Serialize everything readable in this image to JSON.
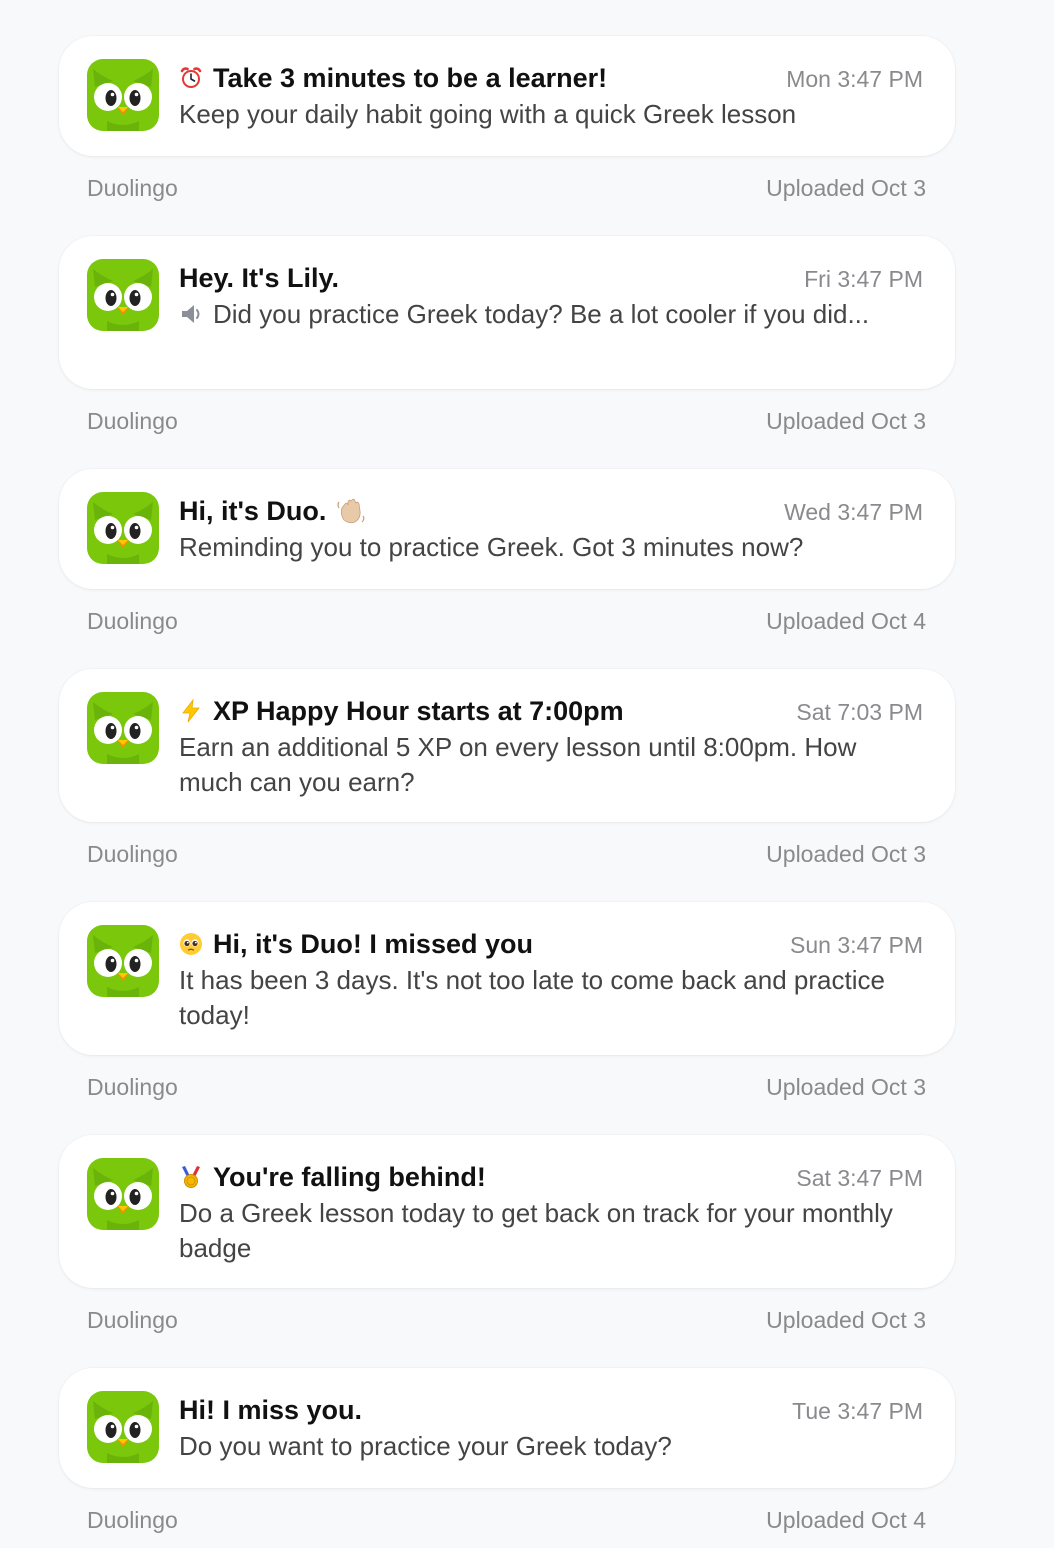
{
  "app": {
    "icon": "duolingo-owl-icon",
    "icon_color": "#7ac70c"
  },
  "notifications": [
    {
      "emoji_icon": "alarm-clock-icon",
      "title": "Take 3 minutes to be a learner!",
      "time": "Mon 3:47 PM",
      "body": "Keep your daily habit going with a quick Greek lesson",
      "source": "Duolingo",
      "uploaded": "Uploaded Oct 3"
    },
    {
      "emoji_icon": "",
      "title": "Hey. It's Lily.",
      "time": "Fri 3:47 PM",
      "body_icon": "speaker-icon",
      "body": "Did you practice Greek today? Be a lot cooler if you did...",
      "source": "Duolingo",
      "uploaded": "Uploaded Oct 3"
    },
    {
      "emoji_icon": "",
      "title": "Hi, it's Duo.",
      "title_suffix_icon": "waving-hand-icon",
      "time": "Wed 3:47 PM",
      "body": "Reminding you to practice Greek. Got 3 minutes now?",
      "source": "Duolingo",
      "uploaded": "Uploaded Oct 4"
    },
    {
      "emoji_icon": "lightning-icon",
      "title": "XP Happy Hour starts at 7:00pm",
      "time": "Sat 7:03 PM",
      "body": "Earn an additional 5 XP on every lesson until 8:00pm. How much can you earn?",
      "source": "Duolingo",
      "uploaded": "Uploaded Oct 3"
    },
    {
      "emoji_icon": "pleading-face-icon",
      "title": "Hi, it's Duo! I missed you",
      "time": "Sun 3:47 PM",
      "body": "It has been 3 days. It's not too late to come back and practice today!",
      "source": "Duolingo",
      "uploaded": "Uploaded Oct 3"
    },
    {
      "emoji_icon": "medal-icon",
      "title": "You're falling behind!",
      "time": "Sat 3:47 PM",
      "body": "Do a Greek lesson today to get back on track for your monthly badge",
      "source": "Duolingo",
      "uploaded": "Uploaded Oct 3"
    },
    {
      "emoji_icon": "",
      "title": "Hi! I miss you.",
      "time": "Tue 3:47 PM",
      "body": "Do you want to practice your Greek today?",
      "source": "Duolingo",
      "uploaded": "Uploaded Oct 4"
    }
  ]
}
